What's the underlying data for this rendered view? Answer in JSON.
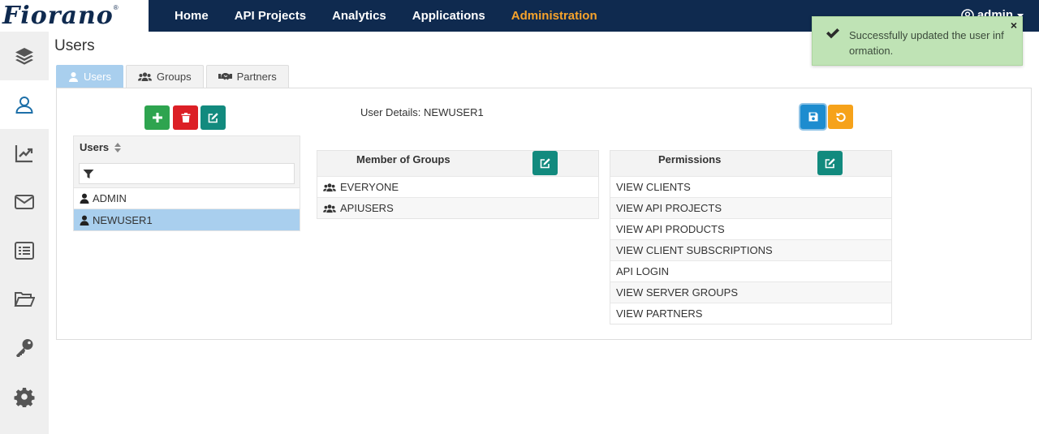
{
  "brand": {
    "logo_text": "Fiorano",
    "reg": "®"
  },
  "nav": {
    "items": [
      {
        "label": "Home",
        "active": false
      },
      {
        "label": "API Projects",
        "active": false
      },
      {
        "label": "Analytics",
        "active": false
      },
      {
        "label": "Applications",
        "active": false
      },
      {
        "label": "Administration",
        "active": true
      }
    ],
    "user": "admin"
  },
  "sidebar": {
    "items": [
      {
        "icon": "layers-icon",
        "active": false
      },
      {
        "icon": "user-icon",
        "active": true
      },
      {
        "icon": "chart-line-icon",
        "active": false
      },
      {
        "icon": "envelope-icon",
        "active": false
      },
      {
        "icon": "list-icon",
        "active": false
      },
      {
        "icon": "folder-open-icon",
        "active": false
      },
      {
        "icon": "key-icon",
        "active": false
      },
      {
        "icon": "gear-icon",
        "active": false
      }
    ]
  },
  "page": {
    "title": "Users"
  },
  "tabs": [
    {
      "label": "Users",
      "icon": "user-icon",
      "active": true
    },
    {
      "label": "Groups",
      "icon": "users-icon",
      "active": false
    },
    {
      "label": "Partners",
      "icon": "handshake-icon",
      "active": false
    }
  ],
  "users_list": {
    "header": "Users",
    "filter_value": "",
    "rows": [
      {
        "name": "ADMIN",
        "selected": false
      },
      {
        "name": "NEWUSER1",
        "selected": true
      }
    ]
  },
  "details": {
    "title": "User Details: NEWUSER1"
  },
  "groups": {
    "title": "Member of Groups",
    "rows": [
      "EVERYONE",
      "APIUSERS"
    ]
  },
  "permissions": {
    "title": "Permissions",
    "rows": [
      "VIEW CLIENTS",
      "VIEW API PROJECTS",
      "VIEW API PRODUCTS",
      "VIEW CLIENT SUBSCRIPTIONS",
      "API LOGIN",
      "VIEW SERVER GROUPS",
      "VIEW PARTNERS"
    ]
  },
  "toast": {
    "message": "Successfully updated the user information."
  },
  "colors": {
    "navbar": "#0f2a4f",
    "active_nav": "#f7a32b",
    "selected_row": "#a9cfee",
    "toast_bg": "#bfe3b5"
  }
}
